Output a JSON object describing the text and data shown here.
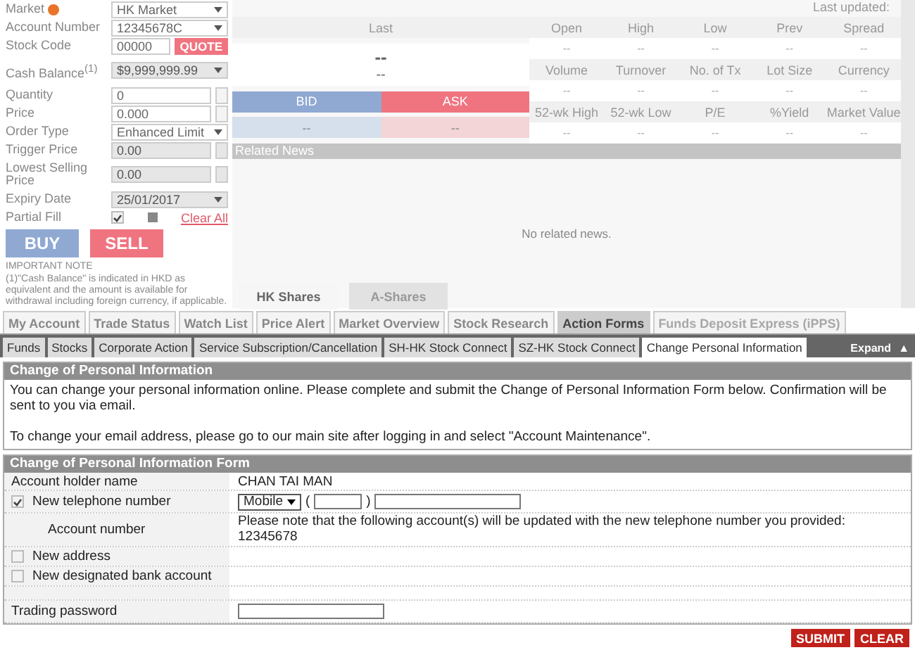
{
  "order_form": {
    "rows": [
      {
        "kind": "select",
        "label": "Market",
        "info": true,
        "value": "HK Market",
        "disabled": false
      },
      {
        "kind": "select",
        "label": "Account Number",
        "value": "12345678C",
        "disabled": false
      },
      {
        "kind": "code",
        "label": "Stock Code",
        "value": "00000",
        "button": "QUOTE"
      },
      {
        "kind": "select",
        "label": "Cash Balance$^{(1)}$",
        "value": "$9,999,999.99",
        "disabled": true
      },
      {
        "kind": "spinner",
        "label": "Quantity",
        "value": "0",
        "disabled": false
      },
      {
        "kind": "spinner",
        "label": "Price",
        "value": "0.000",
        "disabled": false
      },
      {
        "kind": "select",
        "label": "Order Type",
        "value": "Enhanced Limit",
        "disabled": false
      },
      {
        "kind": "spinner",
        "label": "Trigger Price",
        "value": "0.00",
        "disabled": true
      },
      {
        "kind": "spinner",
        "label": "Lowest Selling Price",
        "value": "0.00",
        "disabled": true
      },
      {
        "kind": "select",
        "label": "Expiry Date",
        "value": "25/01/2017",
        "disabled": true
      },
      {
        "kind": "check",
        "label": "Partial Fill",
        "checked": true,
        "link": "Clear All"
      }
    ],
    "buy": "BUY",
    "sell": "SELL",
    "note_title": "IMPORTANT NOTE",
    "note": "(1)\"Cash Balance\" is indicated in HKD as equivalent and the amount is available for withdrawal including foreign currency, if applicable."
  },
  "quote": {
    "last_updated": "Last updated:",
    "last_label": "Last",
    "last_value": "--",
    "last_change": "--",
    "bid": "BID",
    "ask": "ASK",
    "bid_value": "--",
    "ask_value": "--",
    "grid": [
      {
        "headers": [
          "Open",
          "High",
          "Low",
          "Prev",
          "Spread"
        ],
        "values": [
          "--",
          "--",
          "--",
          "--",
          "--"
        ]
      },
      {
        "headers": [
          "Volume",
          "Turnover",
          "No. of Tx",
          "Lot Size",
          "Currency"
        ],
        "values": [
          "--",
          "--",
          "--",
          "--",
          "--"
        ]
      },
      {
        "headers": [
          "52-wk High",
          "52-wk Low",
          "P/E",
          "%Yield",
          "Market Value"
        ],
        "values": [
          "--",
          "--",
          "--",
          "--",
          "--"
        ]
      }
    ]
  },
  "related_news": {
    "title": "Related News",
    "empty": "No related news."
  },
  "market_tabs": [
    {
      "label": "HK Shares",
      "selected": true
    },
    {
      "label": "A-Shares",
      "selected": false
    }
  ],
  "main_tabs": [
    {
      "label": "My Account",
      "selected": false,
      "disabled": false
    },
    {
      "label": "Trade Status",
      "selected": false,
      "disabled": false
    },
    {
      "label": "Watch List",
      "selected": false,
      "disabled": false
    },
    {
      "label": "Price Alert",
      "selected": false,
      "disabled": false
    },
    {
      "label": "Market Overview",
      "selected": false,
      "disabled": false
    },
    {
      "label": "Stock Research",
      "selected": false,
      "disabled": false
    },
    {
      "label": "Action Forms",
      "selected": true,
      "disabled": false
    },
    {
      "label": "Funds Deposit Express (iPPS)",
      "selected": false,
      "disabled": true
    }
  ],
  "sub_tabs": [
    {
      "label": "Funds",
      "selected": false
    },
    {
      "label": "Stocks",
      "selected": false
    },
    {
      "label": "Corporate Action",
      "selected": false
    },
    {
      "label": "Service Subscription/Cancellation",
      "selected": false
    },
    {
      "label": "SH-HK Stock Connect",
      "selected": false
    },
    {
      "label": "SZ-HK Stock Connect",
      "selected": false
    },
    {
      "label": "Change Personal Information",
      "selected": true
    }
  ],
  "expand": {
    "label": "Expand",
    "arrow": "▲"
  },
  "info_section": {
    "title": "Change of Personal Information",
    "paragraphs": [
      "You can change your personal information online. Please complete and submit the Change of Personal Information Form below. Confirmation will be sent to you via email.",
      "To change your email address, please go to our main site after logging in and select \"Account Maintenance\"."
    ]
  },
  "form_section": {
    "title": "Change of Personal Information Form",
    "rows": [
      {
        "kind": "text",
        "label": "Account holder name",
        "value": "CHAN TAI MAN"
      },
      {
        "kind": "phone",
        "label": "New telephone number",
        "checked": true,
        "phone_type": "Mobile",
        "open": "(",
        "close": ")"
      },
      {
        "kind": "note",
        "label": "Account number",
        "note": "Please note that the following account(s) will be updated with the new telephone number you provided:",
        "account": "12345678"
      },
      {
        "kind": "checkbox",
        "label": "New address",
        "checked": false
      },
      {
        "kind": "checkbox",
        "label": "New designated bank account",
        "checked": false
      },
      {
        "kind": "spacer"
      },
      {
        "kind": "password",
        "label": "Trading password"
      }
    ]
  },
  "buttons": [
    "SUBMIT",
    "CLEAR"
  ]
}
